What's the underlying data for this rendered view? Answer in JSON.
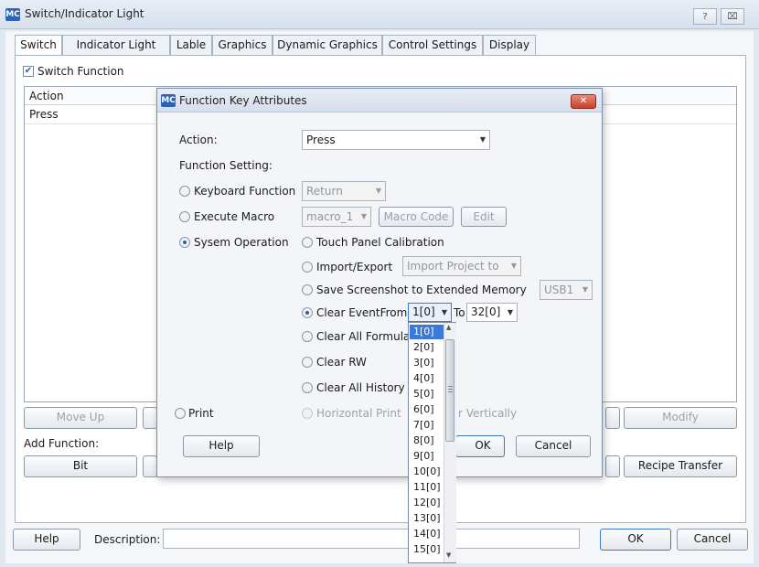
{
  "window": {
    "logo": "MC",
    "title": "Switch/Indicator Light",
    "help_btn": "?",
    "close_btn": "⌧"
  },
  "tabs": [
    "Switch",
    "Indicator Light",
    "Lable",
    "Graphics",
    "Dynamic Graphics",
    "Control Settings",
    "Display"
  ],
  "switch_function": {
    "checked": true,
    "label": "Switch Function"
  },
  "action_list": {
    "header": "Action",
    "rows": [
      "Press"
    ]
  },
  "list_buttons": {
    "move_up": "Move Up",
    "modify": "Modify"
  },
  "add_function": {
    "label": "Add Function:",
    "bit": "Bit",
    "recipe_transfer": "Recipe Transfer"
  },
  "footer": {
    "help": "Help",
    "description_label": "Description:",
    "description_value": "",
    "ok": "OK",
    "cancel": "Cancel"
  },
  "dialog": {
    "logo": "MC",
    "title": "Function Key Attributes",
    "action_label": "Action:",
    "action_value": "Press",
    "function_setting": "Function Setting:",
    "keyboard_function": {
      "label": "Keyboard Function",
      "value": "Return"
    },
    "execute_macro": {
      "label": "Execute Macro",
      "value": "macro_1",
      "macro_code": "Macro Code",
      "edit": "Edit"
    },
    "system_operation": {
      "label": "Sysem Operation",
      "selected": true
    },
    "touch_panel": "Touch Panel Calibration",
    "import_export": {
      "label": "Import/Export",
      "value": "Import Project to"
    },
    "save_screenshot": {
      "label": "Save Screenshot to Extended Memory",
      "value": "USB1"
    },
    "clear_event": {
      "label": "Clear EventFrom",
      "from": "1[0]",
      "to_label": "To",
      "to": "32[0]",
      "selected": true
    },
    "clear_formula": "Clear All Formula",
    "clear_rw": "Clear RW",
    "clear_history": "Clear All History",
    "print": "Print",
    "horizontal_print": "Horizontal Print",
    "vertically": "r Vertically",
    "help": "Help",
    "ok": "OK",
    "cancel": "Cancel"
  },
  "dropdown": {
    "selected": "1[0]",
    "options": [
      "1[0]",
      "2[0]",
      "3[0]",
      "4[0]",
      "5[0]",
      "6[0]",
      "7[0]",
      "8[0]",
      "9[0]",
      "10[0]",
      "11[0]",
      "12[0]",
      "13[0]",
      "14[0]",
      "15[0]"
    ]
  }
}
